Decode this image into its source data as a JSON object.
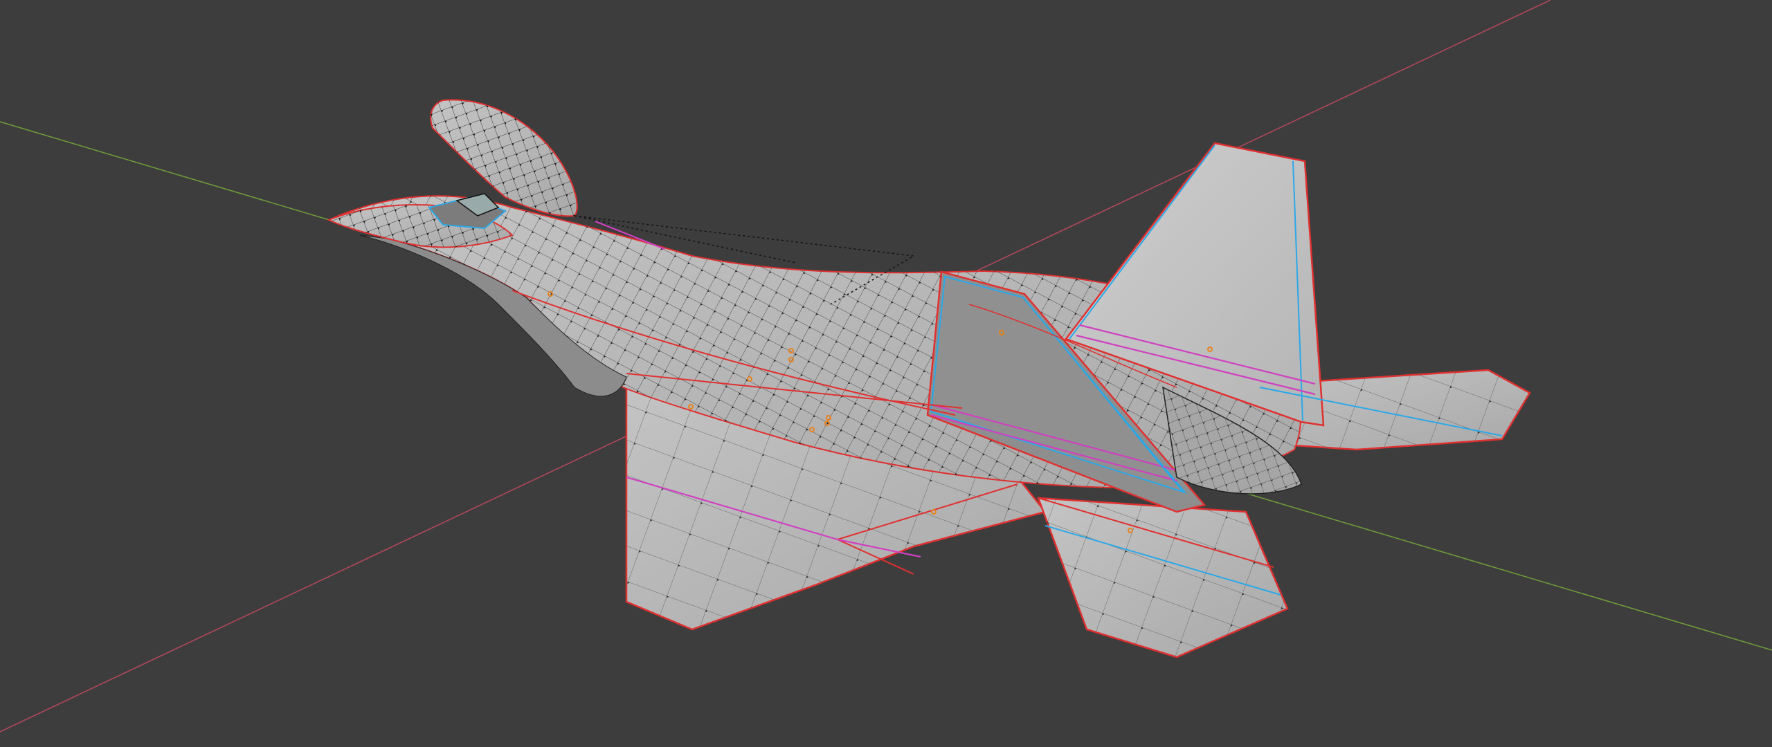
{
  "viewport": {
    "mode": "edit-mode-wireframe-overlay",
    "background_color": "#3d3d3d",
    "axes": {
      "x_axis_color": "#b0485a",
      "y_axis_color": "#6f9a3a"
    },
    "object": {
      "name": "fighter-jet-mesh",
      "surface_color": "#b8b8b8",
      "surface_shadow_color": "#8a8a8a",
      "wire_color": "#1a1a1a",
      "vertex_color": "#000000",
      "seam_color": "#e03030",
      "sharp_edge_color": "#2aa8e8",
      "crease_color": "#d040c0",
      "origin_point_color": "#e8821e"
    }
  }
}
